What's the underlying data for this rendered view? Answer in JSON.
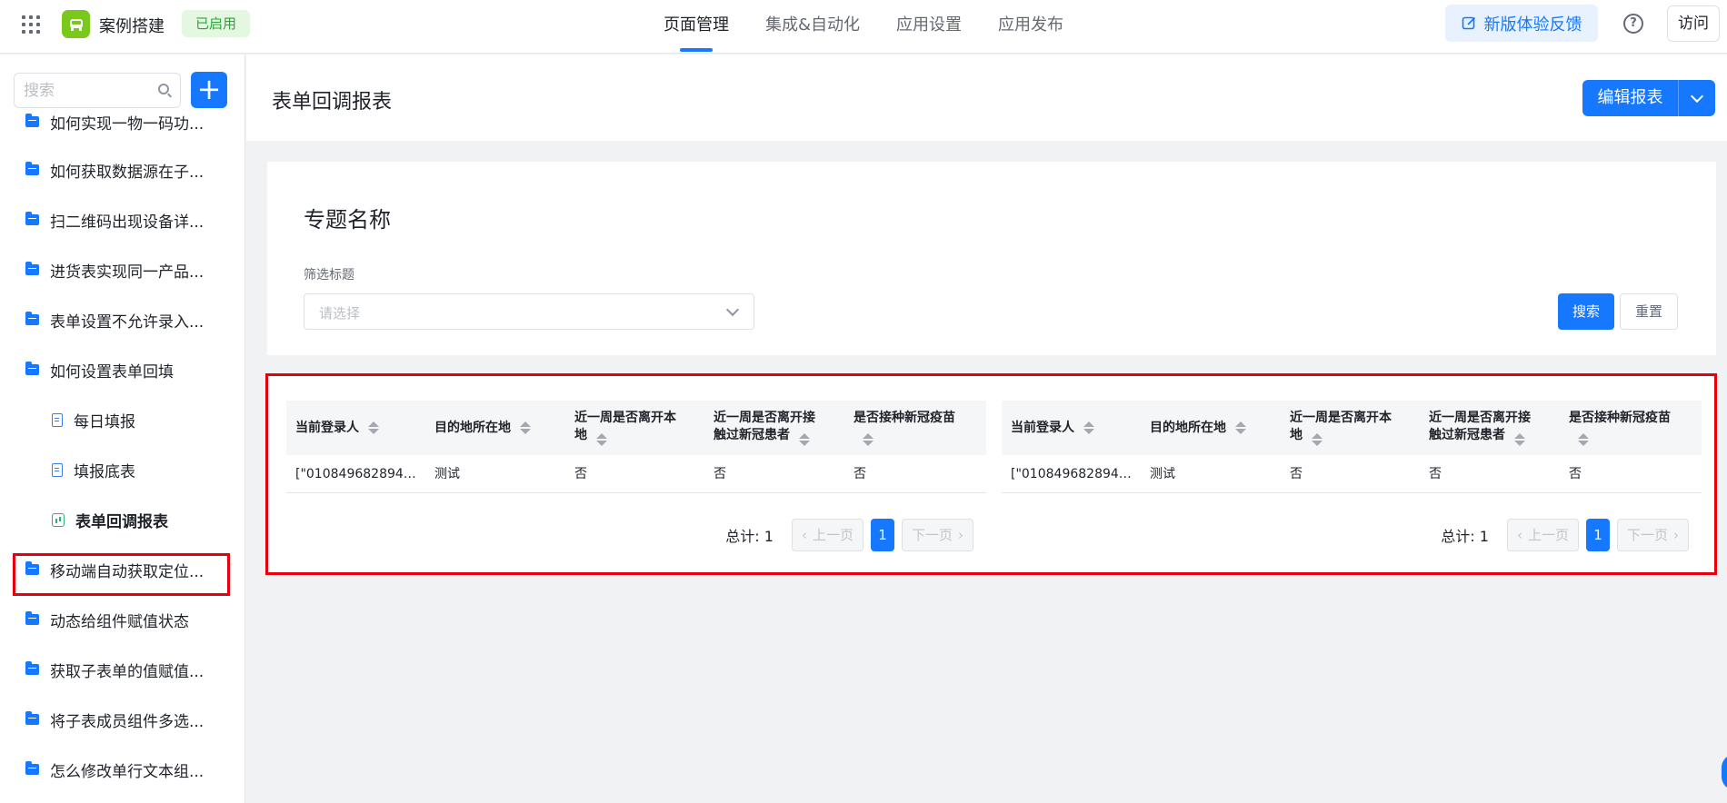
{
  "topbar": {
    "app_name": "案例搭建",
    "status": "已启用",
    "nav": [
      "页面管理",
      "集成&自动化",
      "应用设置",
      "应用发布"
    ],
    "active_nav": "页面管理",
    "feedback_label": "新版体验反馈",
    "help_label": "?",
    "visit_label": "访问"
  },
  "sidebar": {
    "search_placeholder": "搜索",
    "add_label": "+",
    "items": [
      {
        "label": "如何实现一物一码功...",
        "type": "folder"
      },
      {
        "label": "如何获取数据源在子...",
        "type": "folder"
      },
      {
        "label": "扫二维码出现设备详...",
        "type": "folder"
      },
      {
        "label": "进货表实现同一产品...",
        "type": "folder"
      },
      {
        "label": "表单设置不允许录入...",
        "type": "folder"
      },
      {
        "label": "如何设置表单回填",
        "type": "folder-open"
      },
      {
        "label": "每日填报",
        "type": "form"
      },
      {
        "label": "填报底表",
        "type": "form"
      },
      {
        "label": "表单回调报表",
        "type": "report"
      },
      {
        "label": "移动端自动获取定位...",
        "type": "folder"
      },
      {
        "label": "动态给组件赋值状态",
        "type": "folder"
      },
      {
        "label": "获取子表单的值赋值...",
        "type": "folder"
      },
      {
        "label": "将子表成员组件多选...",
        "type": "folder"
      },
      {
        "label": "怎么修改单行文本组...",
        "type": "folder"
      }
    ]
  },
  "main": {
    "page_title": "表单回调报表",
    "edit_label": "编辑报表"
  },
  "filter": {
    "title": "专题名称",
    "label": "筛选标题",
    "placeholder": "请选择",
    "search_label": "搜索",
    "reset_label": "重置"
  },
  "tables": [
    {
      "columns": [
        "当前登录人",
        "目的地所在地",
        "近一周是否离开本地",
        "近一周是否离开接触过新冠患者",
        "是否接种新冠疫苗"
      ],
      "columns_display": [
        [
          "当前登录人"
        ],
        [
          "目的地所在地"
        ],
        [
          "近一周是否离开本",
          "地"
        ],
        [
          "近一周是否离开接",
          "触过新冠患者"
        ],
        [
          "是否接种新冠疫苗"
        ]
      ],
      "rows": [
        [
          "[\"0108496828948...",
          "测试",
          "否",
          "否",
          "否"
        ]
      ],
      "total": "总计: 1",
      "prev": "上一页",
      "page": "1",
      "next": "下一页"
    },
    {
      "columns": [
        "当前登录人",
        "目的地所在地",
        "近一周是否离开本地",
        "近一周是否离开接触过新冠患者",
        "是否接种新冠疫苗"
      ],
      "columns_display": [
        [
          "当前登录人"
        ],
        [
          "目的地所在地"
        ],
        [
          "近一周是否离开本",
          "地"
        ],
        [
          "近一周是否离开接",
          "触过新冠患者"
        ],
        [
          "是否接种新冠疫苗"
        ]
      ],
      "rows": [
        [
          "[\"0108496828948...",
          "测试",
          "否",
          "否",
          "否"
        ]
      ],
      "total": "总计: 1",
      "prev": "上一页",
      "page": "1",
      "next": "下一页"
    }
  ],
  "colors": {
    "primary": "#1677ff",
    "highlight": "#e7000b",
    "logo": "#7ac81b"
  }
}
